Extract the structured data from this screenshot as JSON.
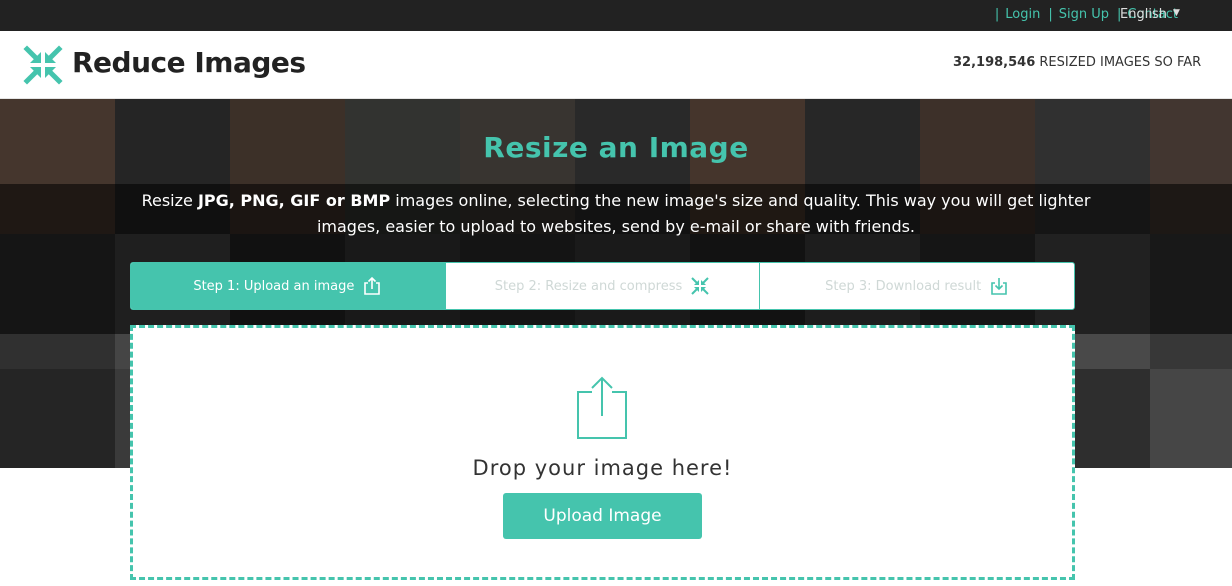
{
  "topbar": {
    "links": [
      {
        "label": "Login"
      },
      {
        "label": "Sign Up"
      },
      {
        "label": "Contact"
      }
    ],
    "language": "English"
  },
  "header": {
    "logo_text": "Reduce Images",
    "counter_value": "32,198,546",
    "counter_suffix": "RESIZED IMAGES SO FAR"
  },
  "hero": {
    "title": "Resize an Image",
    "desc_prefix": "Resize ",
    "desc_formats": "JPG, PNG, GIF or BMP",
    "desc_suffix": " images online, selecting the new image's size and quality. This way you will get lighter images, easier to upload to websites, send by e-mail or share with friends."
  },
  "steps": [
    {
      "label": "Step 1: Upload an image",
      "icon": "upload-icon"
    },
    {
      "label": "Step 2: Resize and compress",
      "icon": "compress-icon"
    },
    {
      "label": "Step 3: Download result",
      "icon": "download-icon"
    }
  ],
  "dropzone": {
    "icon": "share-upload-icon",
    "text": "Drop your image here!",
    "button_label": "Upload Image"
  },
  "colors": {
    "accent": "#45c4ad",
    "topbar": "#222222"
  }
}
